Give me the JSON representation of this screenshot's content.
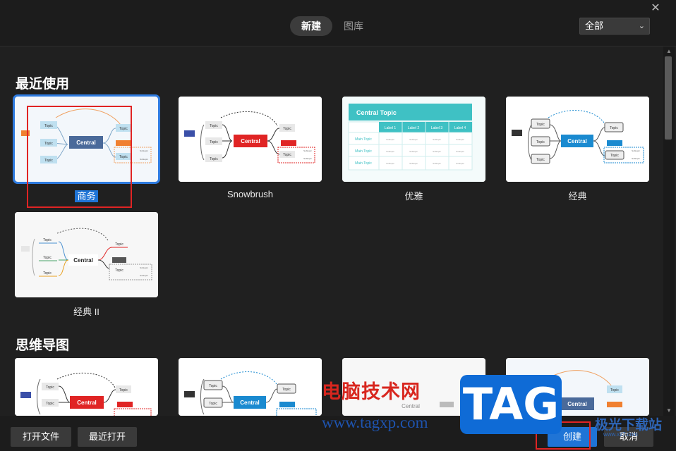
{
  "tabs": {
    "new_label": "新建",
    "library_label": "图库"
  },
  "filter": {
    "selected": "全部"
  },
  "sections": {
    "recent": "最近使用",
    "mindmap": "思维导图"
  },
  "recent_templates": [
    {
      "label": "商务",
      "selected": true
    },
    {
      "label": "Snowbrush"
    },
    {
      "label": "优雅"
    },
    {
      "label": "经典"
    },
    {
      "label": "经典 II"
    }
  ],
  "thumb_text": {
    "central": "Central",
    "topic": "Topic",
    "central_topic": "Central Topic",
    "main_topic": "Main Topic",
    "label1": "Label 1",
    "label2": "Label 2",
    "label3": "Label 3",
    "label4": "Label 4",
    "subtopic": "Subtopic"
  },
  "footer": {
    "open_file": "打开文件",
    "recent_open": "最近打开",
    "create": "创建",
    "cancel": "取消"
  },
  "watermark": {
    "site_cn": "电脑技术网",
    "url": "www.tagxp.com",
    "tag": "TAG",
    "jiguang": "极光下载站",
    "jiguang_url": "www.xz7.com"
  },
  "colors": {
    "accent": "#1f74d6",
    "highlight": "#e02424",
    "background": "#202020"
  }
}
